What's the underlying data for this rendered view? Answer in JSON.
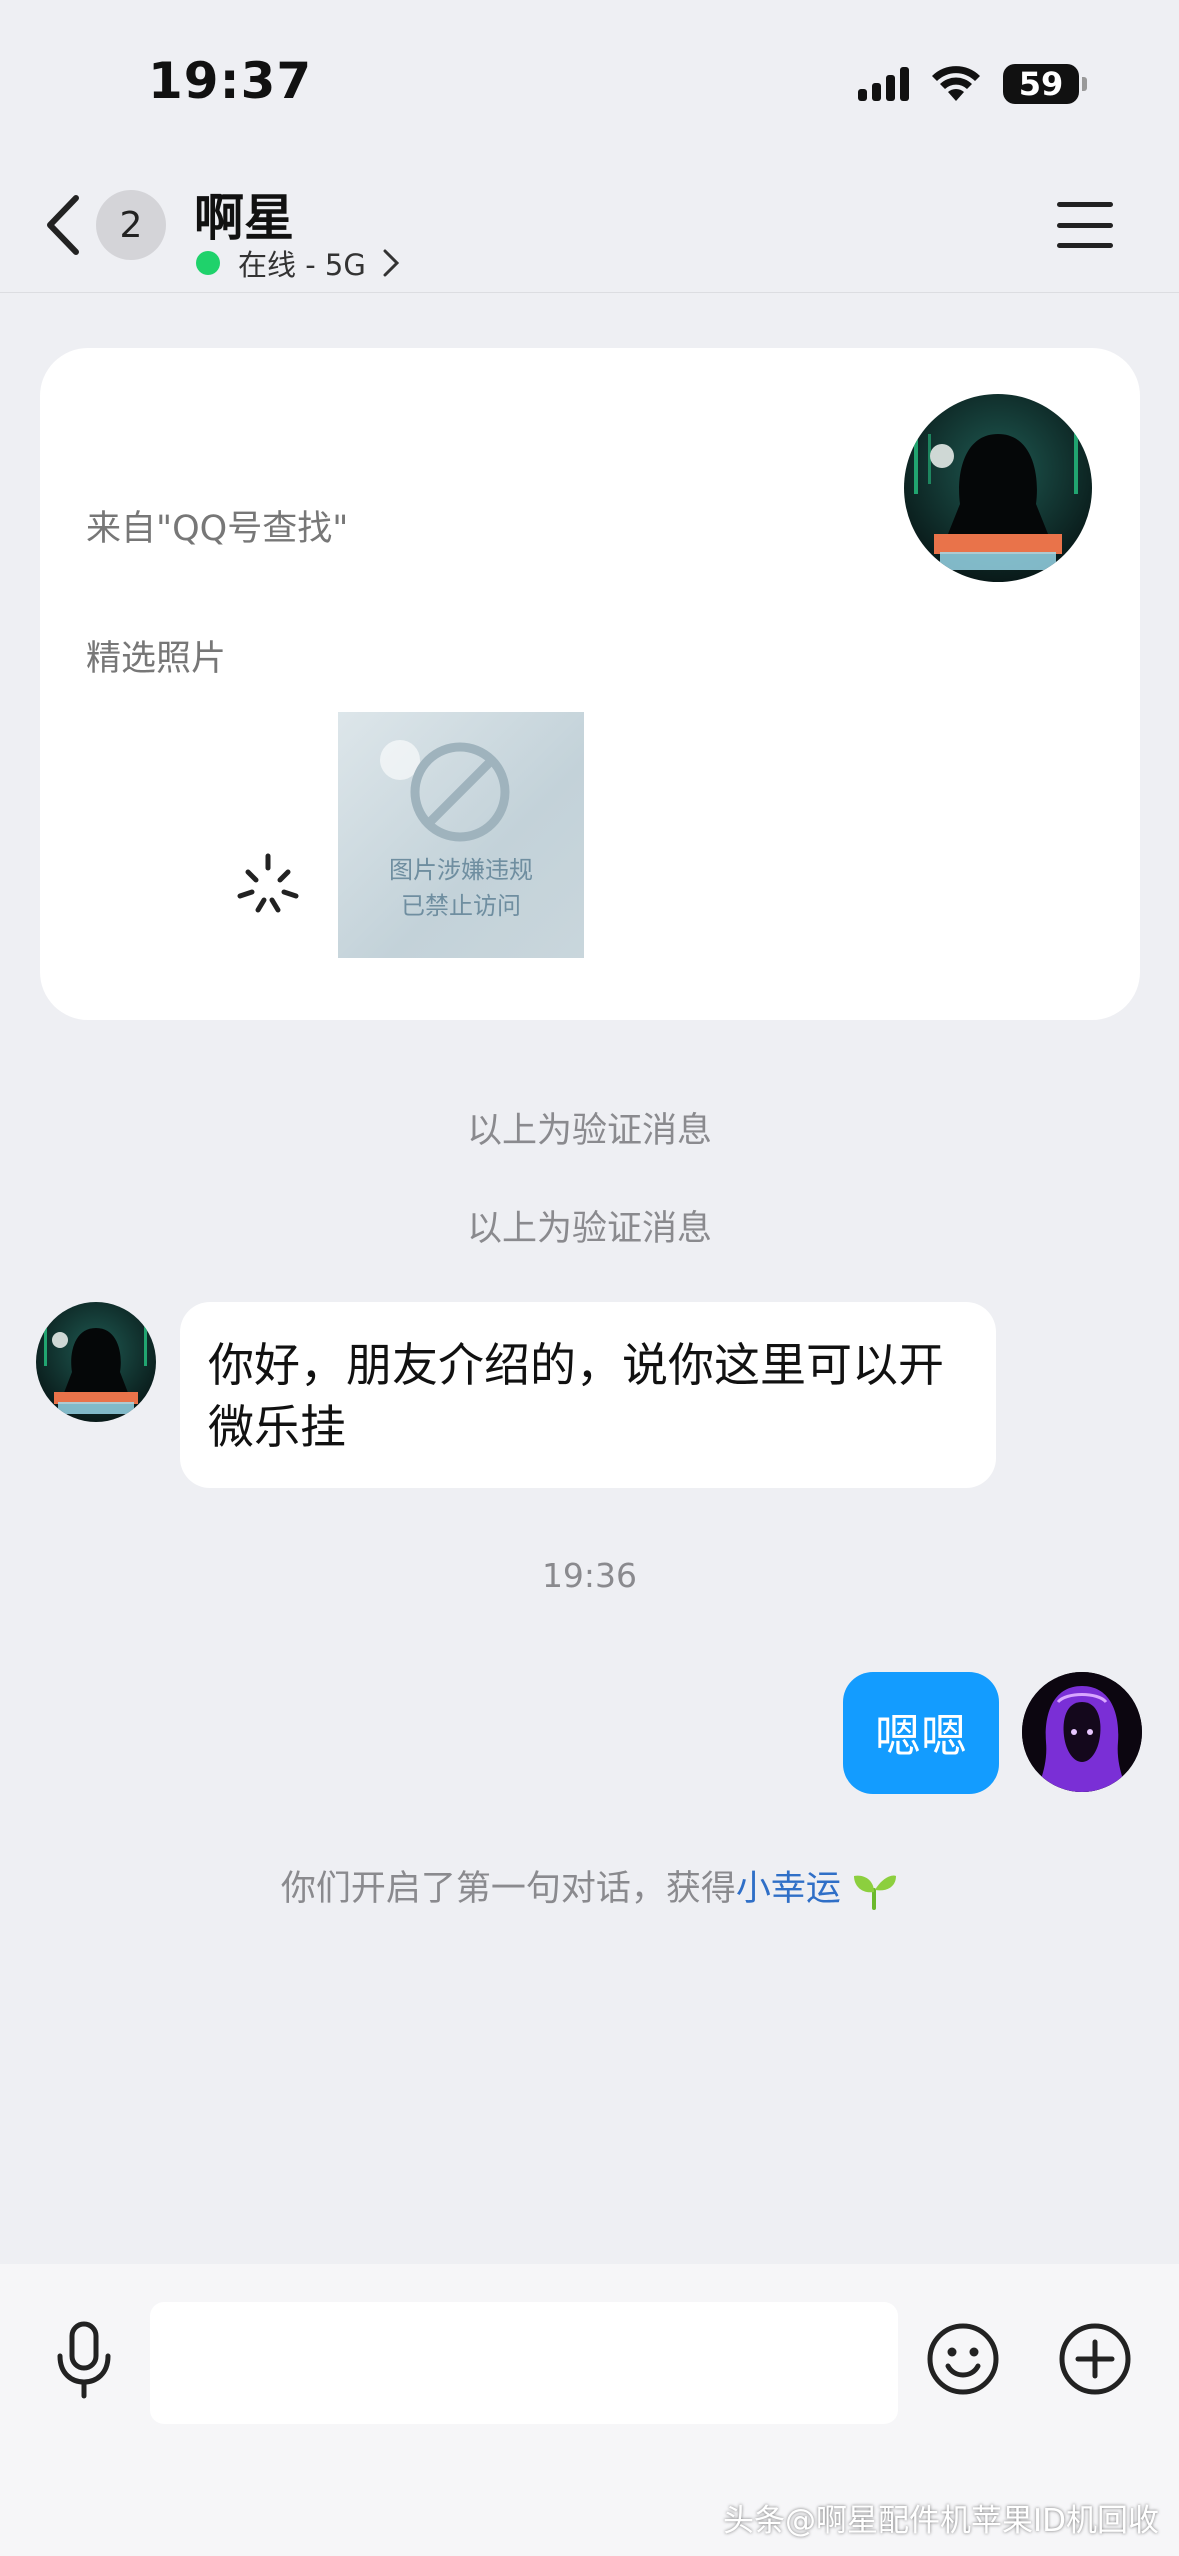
{
  "status_bar": {
    "time": "19:37",
    "battery": "59"
  },
  "header": {
    "unread_count": "2",
    "contact_name": "啊星",
    "presence": "在线 - 5G"
  },
  "verification_card": {
    "source": "来自\"QQ号查找\"",
    "photos_label": "精选照片",
    "blocked_image_line1": "图片涉嫌违规",
    "blocked_image_line2": "已禁止访问"
  },
  "system_messages": [
    "以上为验证消息",
    "以上为验证消息"
  ],
  "messages": [
    {
      "direction": "incoming",
      "text": "你好，朋友介绍的，说你这里可以开微乐挂"
    },
    {
      "direction": "outgoing",
      "text": "嗯嗯"
    }
  ],
  "time_separator": "19:36",
  "lucky_notice": {
    "prefix": "你们开启了第一句对话，获得",
    "link": "小幸运"
  },
  "input": {
    "value": "",
    "placeholder": ""
  },
  "watermark": "头条@啊星配件机苹果ID机回收",
  "colors": {
    "background": "#eeeff3",
    "outgoing_bubble": "#139cff",
    "online_dot": "#1fd26b",
    "link": "#2f6fc7"
  }
}
